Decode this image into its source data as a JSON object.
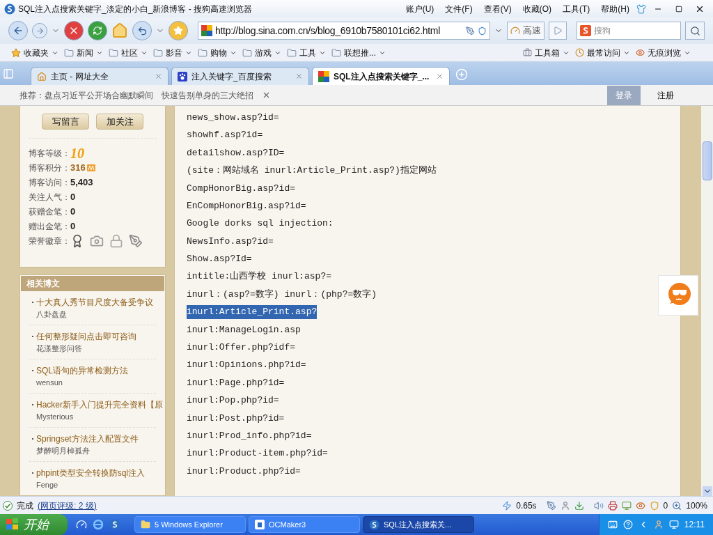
{
  "window": {
    "title": "SQL注入点搜索关键字_淡定的小白_新浪博客 - 搜狗高速浏览器",
    "menus": [
      "账户(U)",
      "文件(F)",
      "查看(V)",
      "收藏(O)",
      "工具(T)",
      "帮助(H)"
    ]
  },
  "toolbar": {
    "url": "http://blog.sina.com.cn/s/blog_6910b7580101ci62.html",
    "speed_button": "高速",
    "search": {
      "placeholder": "搜狗"
    }
  },
  "bookmarks": [
    {
      "label": "收藏夹",
      "kind": "favorites"
    },
    {
      "label": "新闻",
      "kind": "folder"
    },
    {
      "label": "社区",
      "kind": "folder"
    },
    {
      "label": "影音",
      "kind": "folder"
    },
    {
      "label": "购物",
      "kind": "folder"
    },
    {
      "label": "游戏",
      "kind": "folder"
    },
    {
      "label": "工具",
      "kind": "folder"
    },
    {
      "label": "联想推...",
      "kind": "folder"
    }
  ],
  "right_tools": [
    "工具箱",
    "最常访问",
    "无痕浏览"
  ],
  "tabs": [
    {
      "label": "主页 - 网址大全",
      "selected": false
    },
    {
      "label": "注入关键字_百度搜索",
      "selected": false
    },
    {
      "label": "SQL注入点搜索关键字_...",
      "selected": true
    }
  ],
  "recommend_bar": {
    "prefix": "推荐：盘点习近平公开场合幽默瞬间",
    "second": "快速告别单身的三大绝招",
    "login": "登录",
    "register": "注册"
  },
  "sidebar": {
    "buttons": [
      "写留言",
      "加关注"
    ],
    "stats": [
      {
        "label": "博客等级：",
        "value": "10",
        "kind": "level"
      },
      {
        "label": "博客积分：",
        "value": "316",
        "kind": "points"
      },
      {
        "label": "博客访问：",
        "value": "5,403",
        "kind": "count"
      },
      {
        "label": "关注人气：",
        "value": "0",
        "kind": "count"
      },
      {
        "label": "获赠金笔：",
        "value": "0",
        "kind": "count"
      },
      {
        "label": "赠出金笔：",
        "value": "0",
        "kind": "count"
      },
      {
        "label": "荣誉徽章：",
        "kind": "badges"
      }
    ],
    "related": {
      "title": "相关博文",
      "items": [
        {
          "title": "十大真人秀节目尺度大备受争议",
          "author": "八卦盘盘"
        },
        {
          "title": "任何整形疑问点击即可咨询",
          "author": "花漾整形问答"
        },
        {
          "title": "SQL语句的异常检测方法",
          "author": "wensun"
        },
        {
          "title": "Hacker新手入门提升完全资料【原",
          "author": "Mysterious"
        },
        {
          "title": "Springset方法注入配置文件",
          "author": "梦醉明月棹孤舟"
        },
        {
          "title": "phpint类型安全转换防sql注入",
          "author": "Fenge"
        }
      ]
    }
  },
  "article_lines": [
    {
      "text": "news_show.asp?id=",
      "selected": false
    },
    {
      "text": "showhf.asp?id=",
      "selected": false
    },
    {
      "text": "detailshow.asp?ID=",
      "selected": false
    },
    {
      "text": "(site：网站域名 inurl:Article_Print.asp?)指定网站",
      "selected": false
    },
    {
      "text": "CompHonorBig.asp?id=",
      "selected": false
    },
    {
      "text": "EnCompHonorBig.asp?id=",
      "selected": false
    },
    {
      "text": "Google dorks sql injection:",
      "selected": false
    },
    {
      "text": "NewsInfo.asp?id=",
      "selected": false
    },
    {
      "text": "Show.asp?Id=",
      "selected": false
    },
    {
      "text": "intitle:山西学校 inurl:asp?=",
      "selected": false
    },
    {
      "text": "inurl：(asp?=数字) inurl：(php?=数字)",
      "selected": false
    },
    {
      "text": "inurl:Article_Print.asp?",
      "selected": true
    },
    {
      "text": "inurl:ManageLogin.asp",
      "selected": false
    },
    {
      "text": "inurl:Offer.php?idf=",
      "selected": false
    },
    {
      "text": "inurl:Opinions.php?id=",
      "selected": false
    },
    {
      "text": "inurl:Page.php?id=",
      "selected": false
    },
    {
      "text": "inurl:Pop.php?id=",
      "selected": false
    },
    {
      "text": "inurl:Post.php?id=",
      "selected": false
    },
    {
      "text": "inurl:Prod_info.php?id=",
      "selected": false
    },
    {
      "text": "inurl:Product-item.php?id=",
      "selected": false
    },
    {
      "text": "inurl:Product.php?id="
    }
  ],
  "status_bar": {
    "status": "完成",
    "rating": "(网页评级: 2 级)",
    "load_time": "0.65s",
    "shield_count": "0",
    "zoom": "100%"
  },
  "taskbar": {
    "start": "开始",
    "tasks": [
      {
        "label": "5 Windows Explorer",
        "kind": "folder",
        "selected": false
      },
      {
        "label": "OCMaker3",
        "kind": "app",
        "selected": false
      },
      {
        "label": "SQL注入点搜索关...",
        "kind": "browser",
        "selected": true
      }
    ],
    "clock": "12:11"
  }
}
